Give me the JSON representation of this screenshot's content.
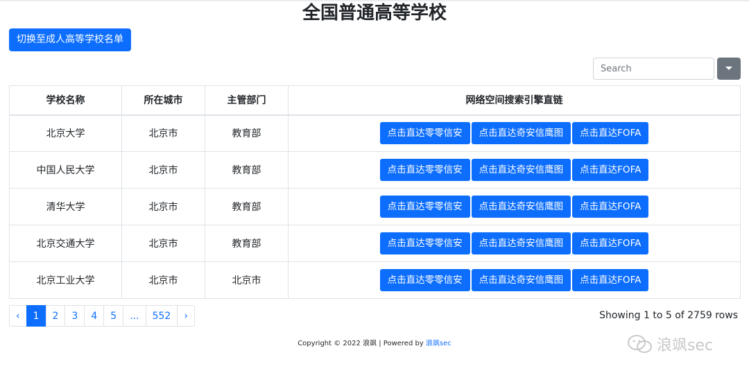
{
  "page": {
    "title": "全国普通高等学校",
    "switch_button": "切换至成人高等学校名单",
    "search_placeholder": "Search"
  },
  "table": {
    "headers": [
      "学校名称",
      "所在城市",
      "主管部门",
      "网络空间搜索引擎直链"
    ],
    "link_labels": [
      "点击直达零零信安",
      "点击直达奇安信鹰图",
      "点击直达FOFA"
    ],
    "rows": [
      {
        "name": "北京大学",
        "city": "北京市",
        "dept": "教育部"
      },
      {
        "name": "中国人民大学",
        "city": "北京市",
        "dept": "教育部"
      },
      {
        "name": "清华大学",
        "city": "北京市",
        "dept": "教育部"
      },
      {
        "name": "北京交通大学",
        "city": "北京市",
        "dept": "教育部"
      },
      {
        "name": "北京工业大学",
        "city": "北京市",
        "dept": "北京市"
      }
    ]
  },
  "pagination": {
    "prev": "‹",
    "pages": [
      "1",
      "2",
      "3",
      "4",
      "5",
      "...",
      "552"
    ],
    "active_page": "1",
    "next": "›",
    "rows_info": "Showing 1 to 5 of 2759 rows"
  },
  "footer": {
    "copyright": "Copyright © 2022 浪飒 | Powered by ",
    "link": "浪飒sec"
  },
  "watermark": {
    "text": "浪飒sec",
    "icon": "wechat-icon"
  },
  "colors": {
    "primary": "#0d6efd",
    "secondary": "#6c757d"
  }
}
